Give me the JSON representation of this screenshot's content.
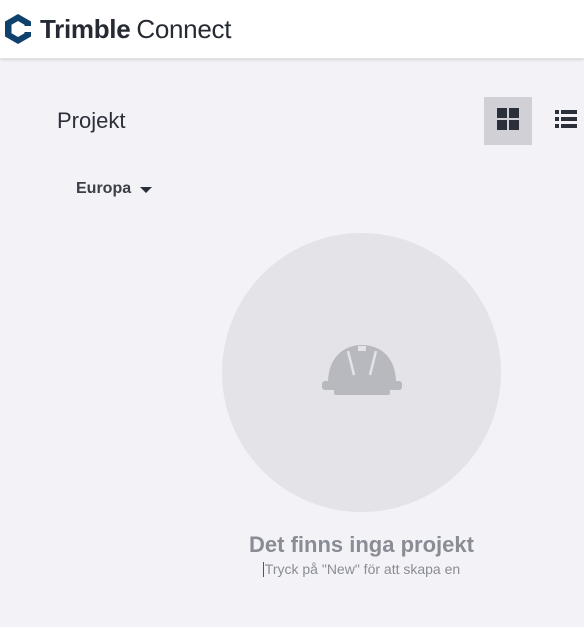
{
  "header": {
    "brand_bold": "Trimble",
    "brand_light": "Connect",
    "logo_icon": "trimble-connect-logo-icon"
  },
  "page": {
    "title": "Projekt"
  },
  "view_toggle": {
    "grid_icon": "grid-view-icon",
    "list_icon": "list-view-icon",
    "selected": "grid"
  },
  "region_selector": {
    "value": "Europa"
  },
  "empty_state": {
    "icon": "hard-hat-icon",
    "title": "Det finns inga projekt",
    "subtitle": "Tryck på \"New\" för att skapa en"
  },
  "colors": {
    "brand_blue": "#0e416c",
    "background": "#f3f3f7",
    "selected_toggle": "#d0d0d6",
    "empty_circle": "#e3e3e8",
    "muted_text": "#8a8c95"
  }
}
